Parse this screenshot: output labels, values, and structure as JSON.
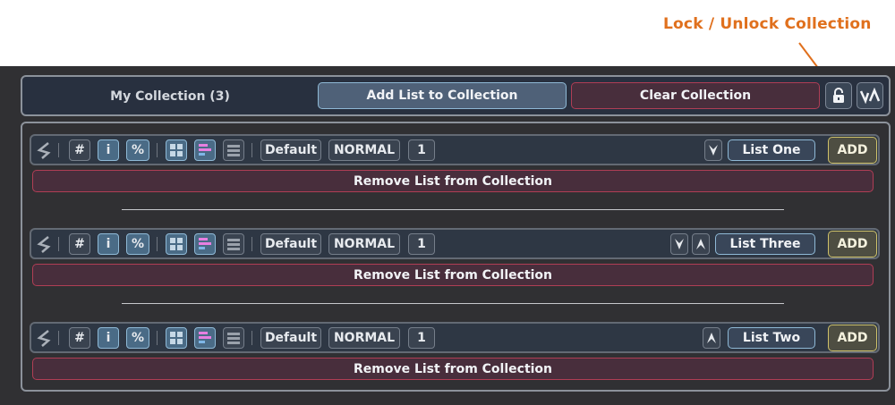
{
  "annotation": {
    "text": "Lock / Unlock Collection",
    "color": "#e0701d"
  },
  "header": {
    "collection_label": "My Collection (3)",
    "add_list_label": "Add List to Collection",
    "clear_label": "Clear Collection",
    "lock_icon": "lock-icon",
    "sort_icon": "sort-icon"
  },
  "lists": [
    {
      "hash_label": "#",
      "info_label": "i",
      "percent_label": "%",
      "style_label": "Default",
      "mode_label": "NORMAL",
      "count_label": "1",
      "name": "List One",
      "add_label": "ADD",
      "remove_label": "Remove List from Collection",
      "move_arrows": [
        "down"
      ]
    },
    {
      "hash_label": "#",
      "info_label": "i",
      "percent_label": "%",
      "style_label": "Default",
      "mode_label": "NORMAL",
      "count_label": "1",
      "name": "List Three",
      "add_label": "ADD",
      "remove_label": "Remove List from Collection",
      "move_arrows": [
        "down",
        "up"
      ]
    },
    {
      "hash_label": "#",
      "info_label": "i",
      "percent_label": "%",
      "style_label": "Default",
      "mode_label": "NORMAL",
      "count_label": "1",
      "name": "List Two",
      "add_label": "ADD",
      "remove_label": "Remove List from Collection",
      "move_arrows": [
        "up"
      ]
    }
  ],
  "colors": {
    "accent_blue": "#8fb9d6",
    "danger_red": "#b03e55",
    "add_gold": "#cfc26a",
    "callout_orange": "#e0701d"
  }
}
